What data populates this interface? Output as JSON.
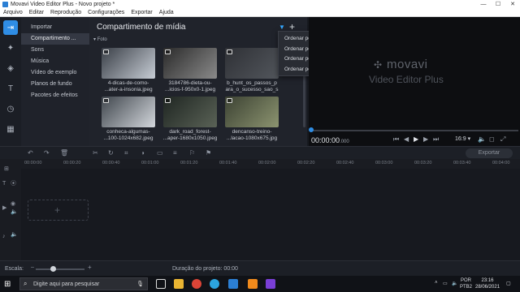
{
  "window": {
    "title": "Movavi Video Editor Plus - Novo projeto *",
    "controls": [
      "—",
      "☐",
      "✕"
    ]
  },
  "menu": [
    "Arquivo",
    "Editar",
    "Reprodução",
    "Configurações",
    "Exportar",
    "Ajuda"
  ],
  "tools": [
    {
      "name": "import-tool-icon",
      "glyph": "⇥"
    },
    {
      "name": "magic-tool-icon",
      "glyph": "✦"
    },
    {
      "name": "filters-tool-icon",
      "glyph": "◈"
    },
    {
      "name": "titles-tool-icon",
      "glyph": "T"
    },
    {
      "name": "stickers-tool-icon",
      "glyph": "◷"
    },
    {
      "name": "more-tools-icon",
      "glyph": "▦"
    }
  ],
  "categories": [
    "Importar",
    "Compartimento ...",
    "Sons",
    "Música",
    "Vídeo de exemplo",
    "Planos de fundo",
    "Pacotes de efeitos"
  ],
  "media": {
    "title": "Compartimento de mídia",
    "section": "Foto",
    "items": [
      {
        "label": "4-dicas-de-como-",
        "label2": "...ater-a-insonia.jpeg",
        "colors": [
          "#3a3f47",
          "#c7cdd5"
        ]
      },
      {
        "label": "3184786-dieta-ou-",
        "label2": "...icios-f-950x0-1.jpeg",
        "colors": [
          "#2a2a2a",
          "#8a8a8a"
        ]
      },
      {
        "label": "b_hunt_os_passos_p",
        "label2": "ara_o_sucesso_sao_s",
        "colors": [
          "#2f3136",
          "#52565c"
        ]
      },
      {
        "label": "conheca-algumas-",
        "label2": "...100-1024x682.jpeg",
        "colors": [
          "#40464d",
          "#d3d7dc"
        ]
      },
      {
        "label": "dark_road_forest-",
        "label2": "...aper-1680x1050.jpeg",
        "colors": [
          "#1f2622",
          "#5a6256"
        ]
      },
      {
        "label": "dencanso-treino-",
        "label2": "...lacao-1080x675.jpg",
        "colors": [
          "#3c4233",
          "#8c9470"
        ]
      }
    ]
  },
  "sort_menu": [
    "Ordenar por tipo de arquivo",
    "Ordenar por nome",
    "Ordenar por data",
    "Ordenar pelo último adicionado"
  ],
  "player": {
    "brand": "movavi",
    "product": "Video Editor Plus",
    "timecode": "00:00:00",
    "timecode_ms": ".000",
    "aspect": "16:9"
  },
  "timeline": {
    "export_label": "Exportar",
    "ticks": [
      "00:00:00",
      "00:00:20",
      "00:00:40",
      "00:01:00",
      "00:01:20",
      "00:01:40",
      "00:02:00",
      "00:02:20",
      "00:02:40",
      "00:03:00",
      "00:03:20",
      "00:03:40",
      "00:04:00"
    ]
  },
  "status": {
    "scale_label": "Escala:",
    "zoom_level": 0.35,
    "duration": "Duração do projeto:  00:00"
  },
  "taskbar": {
    "search_placeholder": "Digite aqui para pesquisar",
    "lang": "POR",
    "layout": "PTB2",
    "time": "23:16",
    "date": "28/06/2021"
  }
}
